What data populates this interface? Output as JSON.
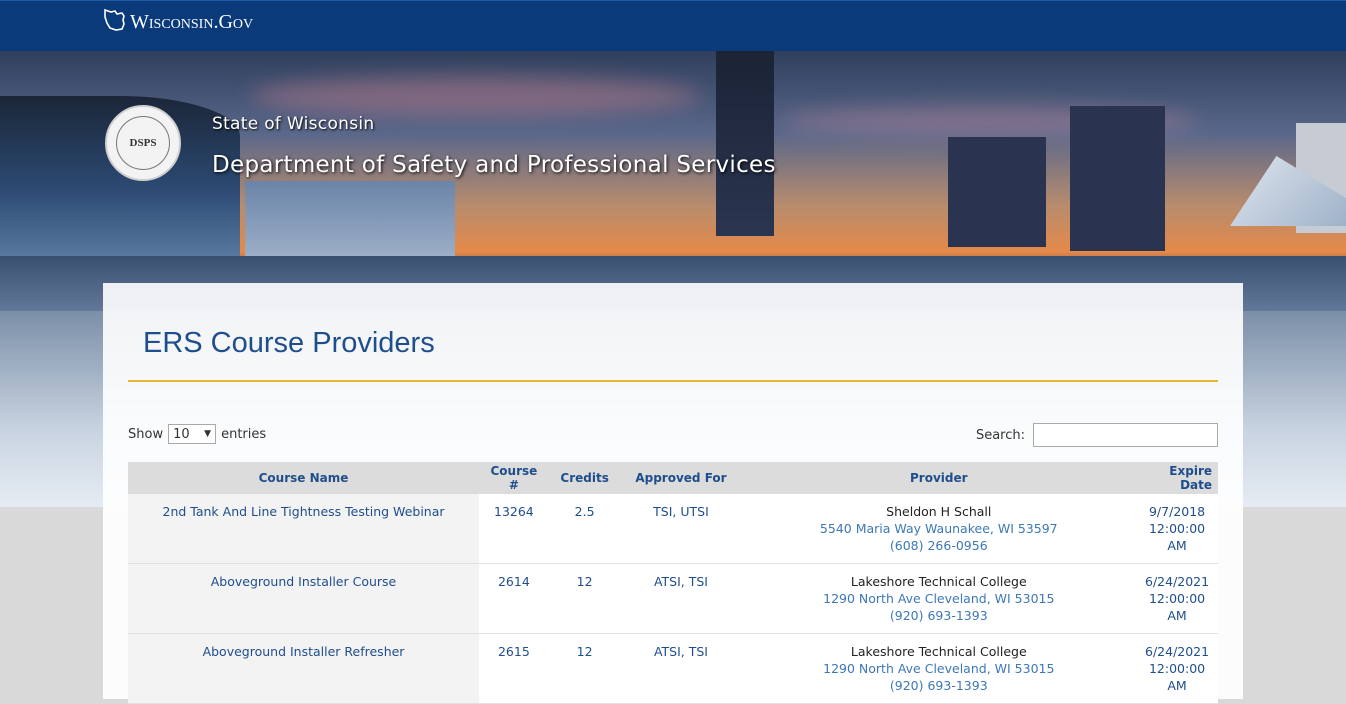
{
  "header": {
    "logo_text": "Wisconsin.Gov",
    "logo_icon": "wisconsin-state-outline-icon"
  },
  "hero": {
    "seal_text": "DSPS",
    "seal_ring_text": "WISCONSIN DEPARTMENT OF SAFETY AND PROFESSIONAL SERVICES",
    "state": "State of Wisconsin",
    "department": "Department of Safety and Professional Services"
  },
  "main": {
    "title": "ERS Course Providers",
    "length": {
      "show_label": "Show",
      "value": "10",
      "entries_label": "entries"
    },
    "search": {
      "label": "Search:",
      "value": "",
      "placeholder": ""
    },
    "table": {
      "columns": [
        "Course Name",
        "Course #",
        "Credits",
        "Approved For",
        "Provider",
        "Expire Date"
      ],
      "rows": [
        {
          "course_name": "2nd Tank And Line Tightness Testing Webinar",
          "course_num": "13264",
          "credits": "2.5",
          "approved_for": "TSI, UTSI",
          "provider_name": "Sheldon H Schall",
          "provider_address": "5540 Maria Way Waunakee, WI 53597",
          "provider_phone": "(608) 266-0956",
          "expire": "9/7/2018 12:00:00 AM"
        },
        {
          "course_name": "Aboveground Installer Course",
          "course_num": "2614",
          "credits": "12",
          "approved_for": "ATSI, TSI",
          "provider_name": "Lakeshore Technical College",
          "provider_address": "1290 North Ave Cleveland, WI 53015",
          "provider_phone": "(920) 693-1393",
          "expire": "6/24/2021 12:00:00 AM"
        },
        {
          "course_name": "Aboveground Installer Refresher",
          "course_num": "2615",
          "credits": "12",
          "approved_for": "ATSI, TSI",
          "provider_name": "Lakeshore Technical College",
          "provider_address": "1290 North Ave Cleveland, WI 53015",
          "provider_phone": "(920) 693-1393",
          "expire": "6/24/2021 12:00:00 AM"
        }
      ]
    }
  },
  "colors": {
    "topbar": "#0b3a7a",
    "title": "#1f4e8c",
    "rule": "#e8b72d",
    "link": "#3d78b9"
  }
}
